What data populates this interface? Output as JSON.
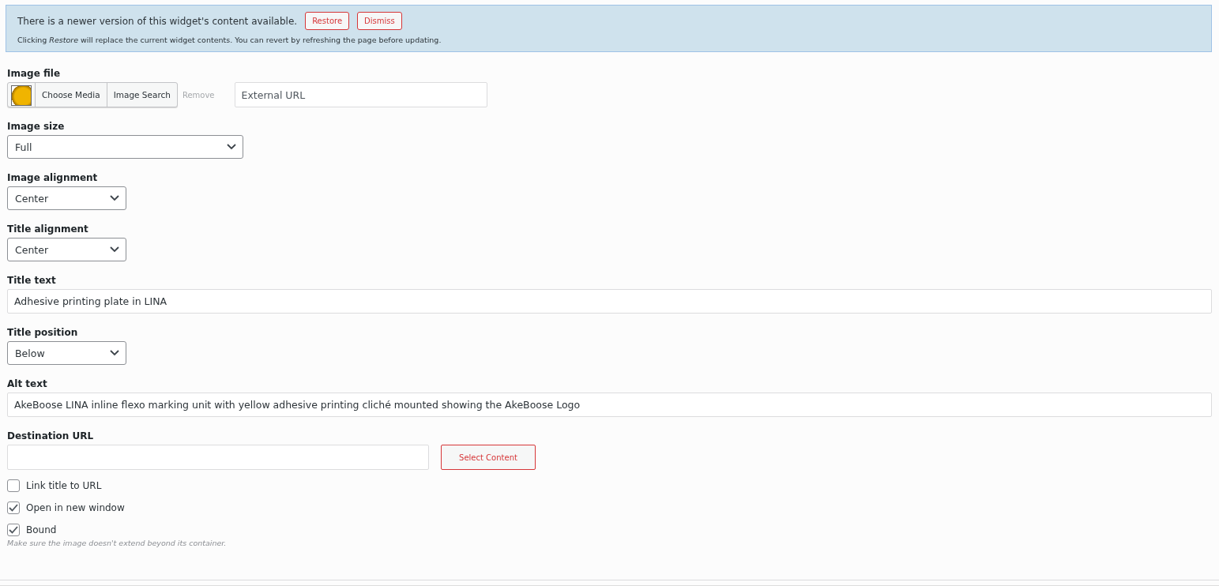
{
  "notice": {
    "message": "There is a newer version of this widget's content available.",
    "buttons": [
      "Restore",
      "Dismiss"
    ],
    "detail": "Clicking *Restore* will replace the current widget contents. You can revert by refreshing the page before updating."
  },
  "fields": [
    {
      "kind": "image",
      "label": "Image file",
      "buttons": [
        "Choose Media",
        "Image Search"
      ],
      "remove": "Remove",
      "placeholder": "External URL"
    },
    {
      "kind": "select",
      "label": "Image size",
      "value": "Full",
      "wide": true
    },
    {
      "kind": "select",
      "label": "Image alignment",
      "value": "Center",
      "wide": false
    },
    {
      "kind": "select",
      "label": "Title alignment",
      "value": "Center",
      "wide": false
    },
    {
      "kind": "text",
      "label": "Title text",
      "value": "Adhesive printing plate in LINA"
    },
    {
      "kind": "select",
      "label": "Title position",
      "value": "Below",
      "wide": false
    },
    {
      "kind": "text",
      "label": "Alt text",
      "value": "AkeBoose LINA inline flexo marking unit with yellow adhesive printing cliché mounted showing the AkeBoose Logo"
    },
    {
      "kind": "url",
      "label": "Destination URL",
      "button": "Select Content"
    }
  ],
  "checkboxes": [
    {
      "label": "Link title to URL",
      "checked": false
    },
    {
      "label": "Open in new window",
      "checked": true
    },
    {
      "label": "Bound",
      "checked": true
    }
  ],
  "hint": "Make sure the image doesn't extend beyond its container."
}
